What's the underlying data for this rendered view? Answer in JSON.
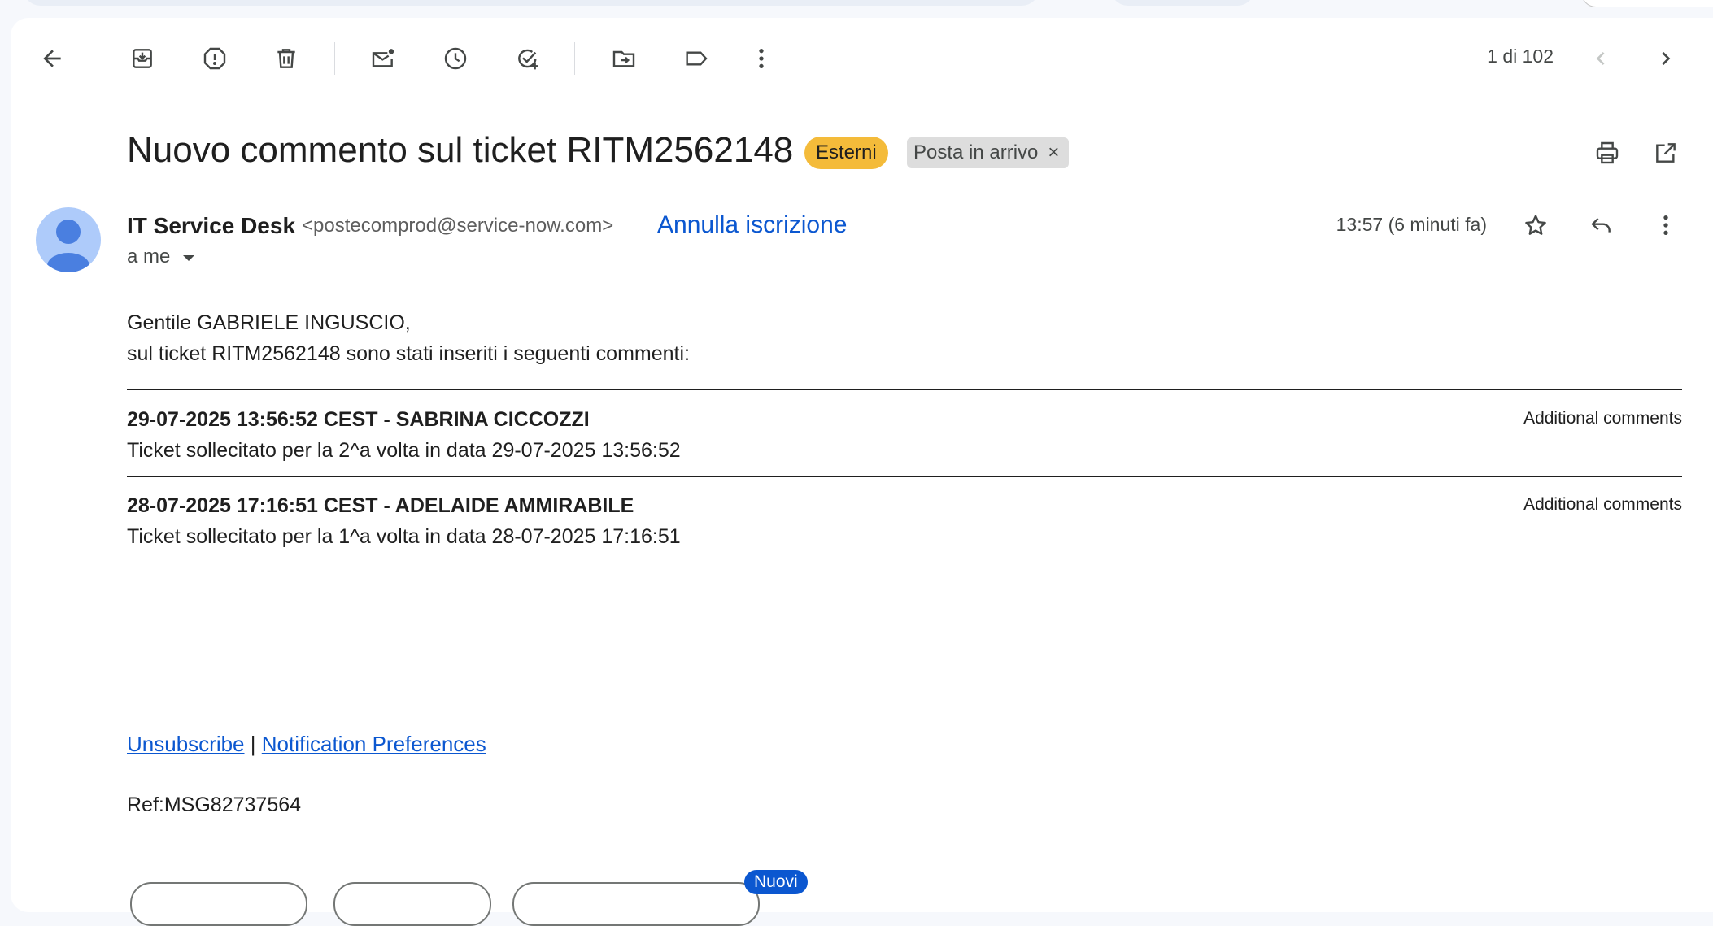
{
  "toolbar": {
    "icons": [
      "back-arrow-icon",
      "archive-icon",
      "report-spam-icon",
      "delete-icon",
      "mark-unread-icon",
      "snooze-icon",
      "add-task-icon",
      "move-to-icon",
      "label-icon",
      "more-vert-icon"
    ],
    "pager": "1 di 102"
  },
  "message": {
    "subject": "Nuovo commento sul ticket RITM2562148",
    "labels": {
      "external": "Esterni",
      "inbox": "Posta in arrivo",
      "remove": "×"
    },
    "sender_name": "IT Service Desk",
    "sender_email": "<postecomprod@service-now.com>",
    "unsubscribe": "Annulla iscrizione",
    "recipient": "a me",
    "time": "13:57 (6 minuti fa)"
  },
  "body": {
    "greeting": "Gentile GABRIELE INGUSCIO,",
    "intro": "sul ticket RITM2562148 sono stati inseriti i seguenti commenti:",
    "comments": [
      {
        "header": "29-07-2025 13:56:52 CEST - SABRINA CICCOZZI",
        "type": "Additional comments",
        "text": "Ticket sollecitato per la 2^a volta in data 29-07-2025 13:56:52"
      },
      {
        "header": "28-07-2025 17:16:51 CEST - ADELAIDE AMMIRABILE",
        "type": "Additional comments",
        "text": "Ticket sollecitato per la 1^a volta in data 28-07-2025 17:16:51"
      }
    ],
    "footer": {
      "unsubscribe": "Unsubscribe",
      "separator": "|",
      "preferences": "Notification Preferences"
    },
    "ref": "Ref:MSG82737564"
  },
  "bottom": {
    "new_badge": "Nuovi"
  },
  "colors": {
    "accent": "#0b57d0",
    "external_chip": "#f4bb3a",
    "avatar_bg": "#aecbfa",
    "avatar_fg": "#4285f4"
  }
}
